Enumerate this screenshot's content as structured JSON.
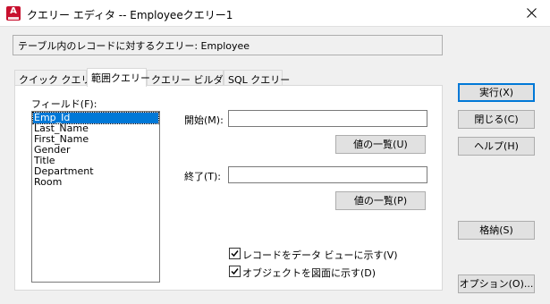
{
  "window": {
    "title": "クエリー エディタ -- Employeeクエリー1",
    "app_icon_letter": "A",
    "icons": {
      "app": "autocad-icon",
      "close": "close-icon",
      "check": "checkmark-icon"
    }
  },
  "info_field": "テーブル内のレコードに対するクエリー:  Employee",
  "tabs": [
    {
      "label": "クイック クエリー",
      "active": false
    },
    {
      "label": "範囲クエリー",
      "active": true
    },
    {
      "label": "クエリー ビルダー",
      "active": false
    },
    {
      "label": "SQL クエリー",
      "active": false
    }
  ],
  "fields": {
    "label": "フィールド(F):",
    "items": [
      "Emp_Id",
      "Last_Name",
      "First_Name",
      "Gender",
      "Title",
      "Department",
      "Room"
    ],
    "selected": "Emp_Id"
  },
  "range": {
    "start_label": "開始(M):",
    "start_value": "",
    "start_list_button": "値の一覧(U)",
    "end_label": "終了(T):",
    "end_value": "",
    "end_list_button": "値の一覧(P)"
  },
  "options": {
    "show_in_data_view": {
      "label": "レコードをデータ ビューに示す(V)",
      "checked": true
    },
    "show_objects": {
      "label": "オブジェクトを図面に示す(D)",
      "checked": true
    }
  },
  "buttons": {
    "execute": "実行(X)",
    "close": "閉じる(C)",
    "help": "ヘルプ(H)",
    "store": "格納(S)",
    "options": "オプション(O)..."
  },
  "colors": {
    "accent": "#0078d7",
    "app_icon": "#c8102e"
  }
}
